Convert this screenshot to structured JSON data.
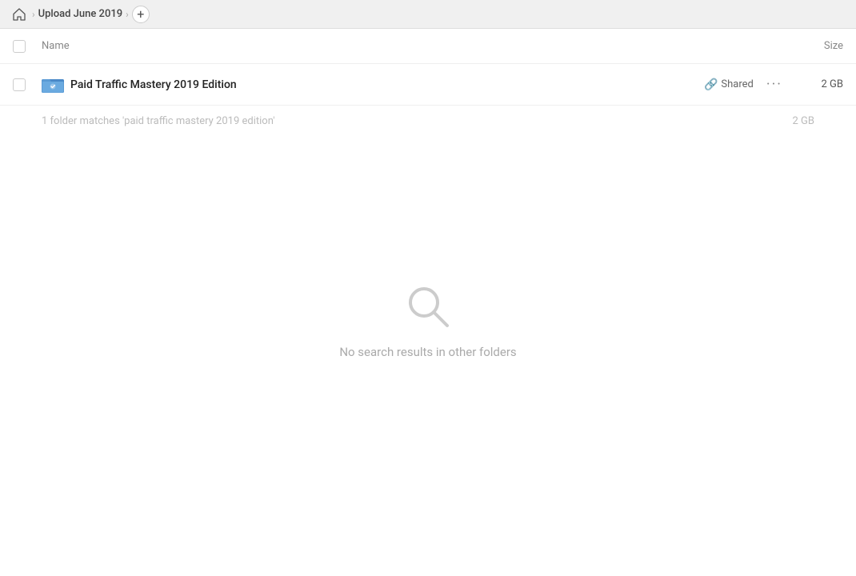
{
  "topbar": {
    "home_icon": "house",
    "breadcrumb_label": "Upload June 2019",
    "add_button_label": "+"
  },
  "table": {
    "column_name": "Name",
    "column_size": "Size"
  },
  "file_row": {
    "name": "Paid Traffic Mastery 2019 Edition",
    "shared_label": "Shared",
    "more_label": "···",
    "size": "2 GB"
  },
  "match_info": {
    "text": "1 folder matches 'paid traffic mastery 2019 edition'",
    "size": "2 GB"
  },
  "empty_state": {
    "message": "No search results in other folders"
  }
}
